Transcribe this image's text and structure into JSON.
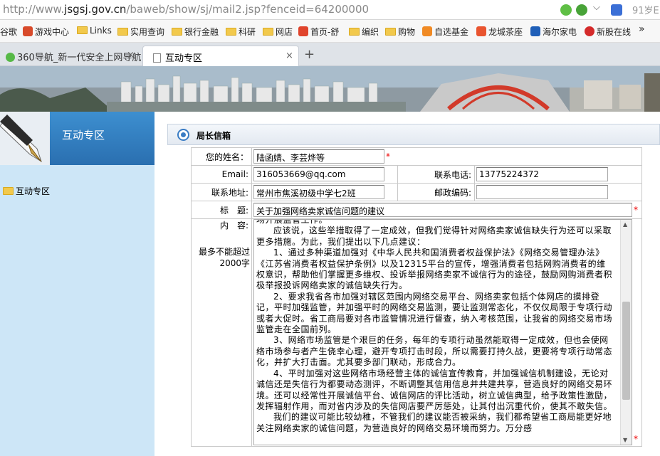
{
  "browser": {
    "address_prefix": "http://www.",
    "address_domain": "jsgsj.gov.cn",
    "address_suffix": "/baweb/show/sj/mail2.jsp?fenceid=64200000",
    "search_hint": "91岁E",
    "bookmarks": [
      "谷歌",
      "游戏中心",
      "Links",
      "实用查询",
      "银行金融",
      "科研",
      "网店",
      "首页-舒",
      "编织",
      "购物",
      "自选基金",
      "龙城茶座",
      "海尔家电",
      "新股在线"
    ],
    "more_glyph": "»",
    "tabs": [
      {
        "label": "360导航_新一代安全上网导航"
      },
      {
        "label": "互动专区"
      }
    ],
    "close_glyph": "×",
    "new_tab_glyph": "+"
  },
  "sidebar": {
    "title": "互动专区",
    "tree_item": "互动专区"
  },
  "section": {
    "title": "局长信箱"
  },
  "form": {
    "name_label": "您的姓名：",
    "name_value": "陆函婧、李芸烨等",
    "email_label": "Email:",
    "email_value": "316053669@qq.com",
    "phone_label": "联系电话:",
    "phone_value": "13775224372",
    "address_label": "联系地址:",
    "address_value": "常州市焦溪初级中学七2班",
    "postcode_label": "邮政编码:",
    "postcode_value": "",
    "subject_label": "标　题:",
    "subject_value": "关于加强网络卖家诚信问题的建议",
    "content_label": "内　容:",
    "content_limit": "最多不能超过2000字",
    "required_mark": "*",
    "content_paragraphs": [
      "场开展监管工作。",
      "应该说，这些举措取得了一定成效，但我们觉得针对网络卖家诚信缺失行为还可以采取更多措施。为此，我们提出以下几点建议：",
      "1、通过多种渠道加强对《中华人民共和国消费者权益保护法》《网络交易管理办法》《江苏省消费者权益保护条例》以及12315平台的宣传，增强消费者包括网购消费者的维权意识，帮助他们掌握更多维权、投诉举报网络卖家不诚信行为的途径，鼓励网购消费者积极举报投诉网络卖家的诚信缺失行为。",
      "2、要求我省各市加强对辖区范围内网络交易平台、网络卖家包括个体网店的摸排登记，平时加强监管，并加强平时的网络交易监测，要让监测常态化，不仅仅局限于专项行动或者大促时。省工商局要对各市监管情况进行督查，纳入考核范围，让我省的网络交易市场监管走在全国前列。",
      "3、网络市场监管是个艰巨的任务，每年的专项行动虽然能取得一定成效，但也会使网络市场参与者产生侥幸心理，避开专项打击时段，所以需要打持久战，更要将专项行动常态化，并扩大打击面。尤其要多部门联动，形成合力。",
      "4、平时加强对这些网络市场经营主体的诚信宣传教育，并加强诚信机制建设，无论对诚信还是失信行为都要动态测评，不断调整其信用信息并共建共享，营造良好的网络交易环境。还可以经常性开展诚信平台、诚信网店的评比活动，树立诚信典型，给予政策性激励，发挥辐射作用，而对省内涉及的失信网店要严厉惩处，让其付出沉重代价，使其不敢失信。",
      "我们的建议可能比较幼稚，不管我们的建议能否被采纳，我们都希望省工商局能更好地关注网络卖家的诚信问题，为营造良好的网络交易环境而努力。万分感"
    ]
  },
  "colors": {
    "sidebar_bg": "#cde6f7",
    "sidebar_head": "#2a6fb0",
    "accent": "#3a7cc4"
  }
}
